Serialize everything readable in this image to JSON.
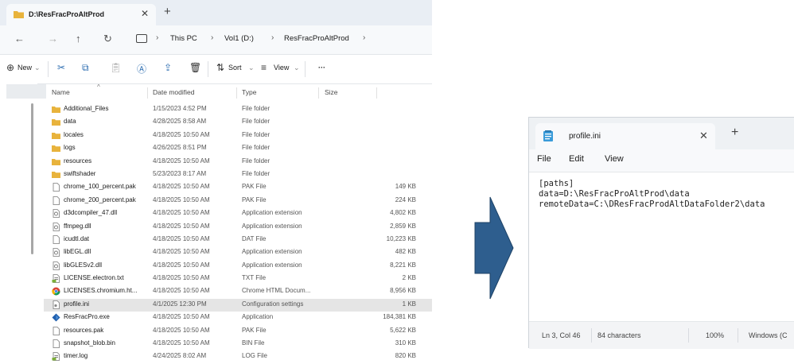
{
  "explorer": {
    "tab_title": "D:\\ResFracProAltProd",
    "tab_close": "✕",
    "tab_new": "+",
    "nav": {
      "back": "←",
      "forward": "→",
      "up": "↑",
      "refresh": "↻"
    },
    "breadcrumb": [
      "This PC",
      "Vol1 (D:)",
      "ResFracProAltProd"
    ],
    "breadcrumb_sep": "›",
    "commands": {
      "new": "New",
      "sort": "Sort",
      "view": "View",
      "more": "···"
    },
    "columns": {
      "name": "Name",
      "date": "Date modified",
      "type": "Type",
      "size": "Size"
    },
    "files": [
      {
        "name": "Additional_Files",
        "date": "1/15/2023 4:52 PM",
        "type": "File folder",
        "size": "",
        "icon": "folder-icon"
      },
      {
        "name": "data",
        "date": "4/28/2025 8:58 AM",
        "type": "File folder",
        "size": "",
        "icon": "folder-icon"
      },
      {
        "name": "locales",
        "date": "4/18/2025 10:50 AM",
        "type": "File folder",
        "size": "",
        "icon": "folder-icon"
      },
      {
        "name": "logs",
        "date": "4/26/2025 8:51 PM",
        "type": "File folder",
        "size": "",
        "icon": "folder-icon"
      },
      {
        "name": "resources",
        "date": "4/18/2025 10:50 AM",
        "type": "File folder",
        "size": "",
        "icon": "folder-icon"
      },
      {
        "name": "swiftshader",
        "date": "5/23/2023 8:17 AM",
        "type": "File folder",
        "size": "",
        "icon": "folder-icon"
      },
      {
        "name": "chrome_100_percent.pak",
        "date": "4/18/2025 10:50 AM",
        "type": "PAK File",
        "size": "149 KB",
        "icon": "file-icon"
      },
      {
        "name": "chrome_200_percent.pak",
        "date": "4/18/2025 10:50 AM",
        "type": "PAK File",
        "size": "224 KB",
        "icon": "file-icon"
      },
      {
        "name": "d3dcompiler_47.dll",
        "date": "4/18/2025 10:50 AM",
        "type": "Application extension",
        "size": "4,802 KB",
        "icon": "dll-icon"
      },
      {
        "name": "ffmpeg.dll",
        "date": "4/18/2025 10:50 AM",
        "type": "Application extension",
        "size": "2,859 KB",
        "icon": "dll-icon"
      },
      {
        "name": "icudtl.dat",
        "date": "4/18/2025 10:50 AM",
        "type": "DAT File",
        "size": "10,223 KB",
        "icon": "file-icon"
      },
      {
        "name": "libEGL.dll",
        "date": "4/18/2025 10:50 AM",
        "type": "Application extension",
        "size": "482 KB",
        "icon": "dll-icon"
      },
      {
        "name": "libGLESv2.dll",
        "date": "4/18/2025 10:50 AM",
        "type": "Application extension",
        "size": "8,221 KB",
        "icon": "dll-icon"
      },
      {
        "name": "LICENSE.electron.txt",
        "date": "4/18/2025 10:50 AM",
        "type": "TXT File",
        "size": "2 KB",
        "icon": "text-file-icon"
      },
      {
        "name": "LICENSES.chromium.ht...",
        "date": "4/18/2025 10:50 AM",
        "type": "Chrome HTML Docum...",
        "size": "8,956 KB",
        "icon": "chrome-html-icon"
      },
      {
        "name": "profile.ini",
        "date": "4/1/2025 12:30 PM",
        "type": "Configuration settings",
        "size": "1 KB",
        "icon": "ini-file-icon",
        "selected": true
      },
      {
        "name": "ResFracPro.exe",
        "date": "4/18/2025 10:50 AM",
        "type": "Application",
        "size": "184,381 KB",
        "icon": "app-icon"
      },
      {
        "name": "resources.pak",
        "date": "4/18/2025 10:50 AM",
        "type": "PAK File",
        "size": "5,622 KB",
        "icon": "file-icon"
      },
      {
        "name": "snapshot_blob.bin",
        "date": "4/18/2025 10:50 AM",
        "type": "BIN File",
        "size": "310 KB",
        "icon": "file-icon"
      },
      {
        "name": "timer.log",
        "date": "4/24/2025 8:02 AM",
        "type": "LOG File",
        "size": "820 KB",
        "icon": "text-file-icon"
      }
    ]
  },
  "notepad": {
    "tab_title": "profile.ini",
    "tab_close": "✕",
    "tab_new": "+",
    "menu": [
      "File",
      "Edit",
      "View"
    ],
    "lines": [
      "[paths]",
      "data=D:\\ResFracProAltProd\\data",
      "remoteData=C:\\DResFracProdAltDataFolder2\\data"
    ],
    "status": {
      "position": "Ln 3, Col 46",
      "chars": "84 characters",
      "zoom": "100%",
      "eol": "Windows (C"
    }
  },
  "colors": {
    "arrow": "#2e5e8e",
    "folder": "#e8b33c",
    "selected_row": "#e5e5e5"
  }
}
